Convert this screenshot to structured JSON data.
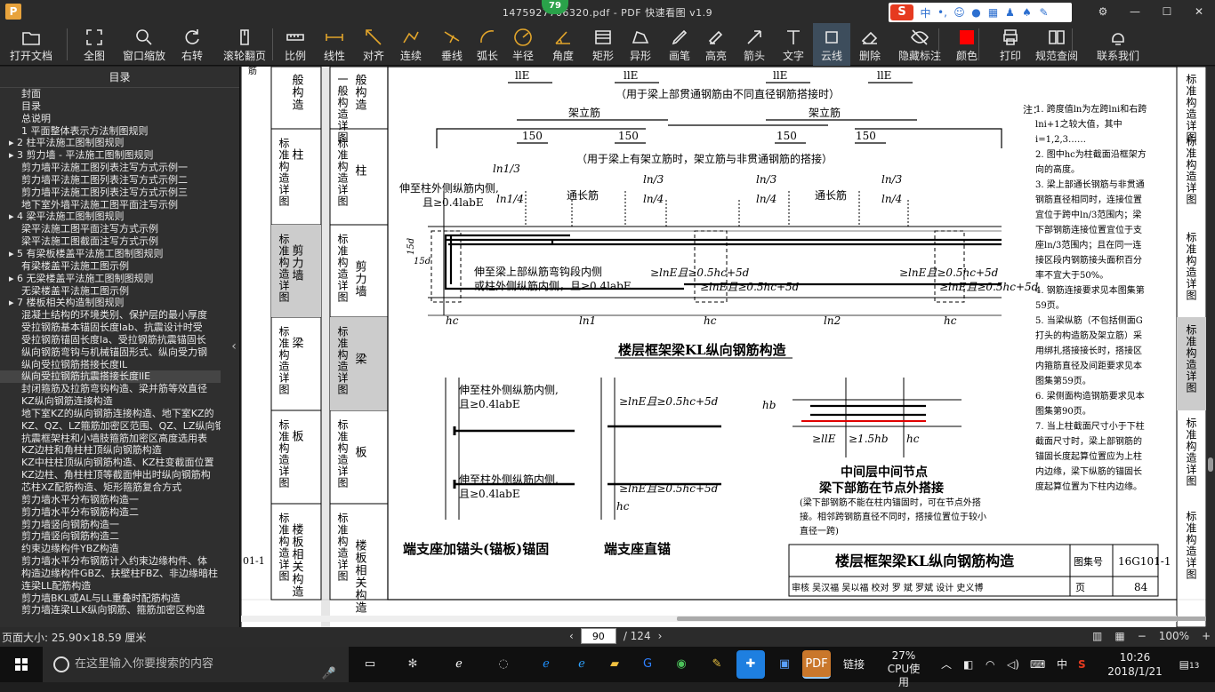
{
  "window": {
    "title": "1475927706320.pdf - PDF 快速看图 v1.9",
    "badge": "79",
    "app_icon": "P"
  },
  "ime": {
    "brand": "S",
    "mode": "中"
  },
  "toolbar": [
    {
      "label": "打开文档",
      "icon": "folder-icon"
    },
    {
      "label": "全图",
      "icon": "fullscreen-icon"
    },
    {
      "label": "窗口缩放",
      "icon": "zoom-icon"
    },
    {
      "label": "右转",
      "icon": "rotate-icon"
    },
    {
      "label": "滚轮翻页",
      "icon": "mouse-icon"
    },
    {
      "label": "比例",
      "icon": "scale-icon"
    },
    {
      "label": "线性",
      "icon": "linear-icon"
    },
    {
      "label": "对齐",
      "icon": "align-icon"
    },
    {
      "label": "连续",
      "icon": "continuous-icon"
    },
    {
      "label": "垂线",
      "icon": "perpendicular-icon"
    },
    {
      "label": "弧长",
      "icon": "arc-icon"
    },
    {
      "label": "半径",
      "icon": "radius-icon"
    },
    {
      "label": "角度",
      "icon": "angle-icon"
    },
    {
      "label": "矩形",
      "icon": "rectangle-icon"
    },
    {
      "label": "异形",
      "icon": "polygon-icon"
    },
    {
      "label": "画笔",
      "icon": "pen-icon"
    },
    {
      "label": "高亮",
      "icon": "highlighter-icon"
    },
    {
      "label": "箭头",
      "icon": "arrow-icon"
    },
    {
      "label": "文字",
      "icon": "text-icon"
    },
    {
      "label": "云线",
      "icon": "cloud-icon"
    },
    {
      "label": "删除",
      "icon": "eraser-icon"
    },
    {
      "label": "隐藏标注",
      "icon": "eye-off-icon"
    },
    {
      "label": "颜色",
      "icon": "color-icon",
      "color": "#ff0000"
    },
    {
      "label": "打印",
      "icon": "printer-icon"
    },
    {
      "label": "规范查阅",
      "icon": "book-icon"
    },
    {
      "label": "联系我们",
      "icon": "support-icon"
    }
  ],
  "sidebar": {
    "title": "目录",
    "items": [
      {
        "text": "封面",
        "level": 0
      },
      {
        "text": "目录",
        "level": 0
      },
      {
        "text": "总说明",
        "level": 0
      },
      {
        "text": "1 平面整体表示方法制图规则",
        "level": 0
      },
      {
        "text": "2 柱平法施工图制图规则",
        "level": 1,
        "expand": "▸"
      },
      {
        "text": "3 剪力墙 - 平法施工图制图规则",
        "level": 1,
        "expand": "▸"
      },
      {
        "text": "剪力墙平法施工图列表注写方式示例一",
        "level": 2
      },
      {
        "text": "剪力墙平法施工图列表注写方式示例二",
        "level": 2
      },
      {
        "text": "剪力墙平法施工图列表注写方式示例三",
        "level": 2
      },
      {
        "text": "地下室外墙平法施工图平面注写示例",
        "level": 2
      },
      {
        "text": "4 梁平法施工图制图规则",
        "level": 1,
        "expand": "▸"
      },
      {
        "text": "梁平法施工图平面注写方式示例",
        "level": 2
      },
      {
        "text": "梁平法施工图截面注写方式示例",
        "level": 2
      },
      {
        "text": "5 有梁板楼盖平法施工图制图规则",
        "level": 1,
        "expand": "▸"
      },
      {
        "text": "有梁楼盖平法施工图示例",
        "level": 2
      },
      {
        "text": "6 无梁楼盖平法施工图制图规则",
        "level": 1,
        "expand": "▸"
      },
      {
        "text": "无梁楼盖平法施工图示例",
        "level": 2
      },
      {
        "text": "7 楼板相关构造制图规则",
        "level": 1,
        "expand": "▸"
      },
      {
        "text": "混凝土结构的环境类别、保护层的最小厚度",
        "level": 2
      },
      {
        "text": "受拉钢筋基本锚固长度lab、抗震设计时受",
        "level": 2
      },
      {
        "text": "受拉钢筋锚固长度la、受拉钢筋抗震锚固长",
        "level": 2
      },
      {
        "text": "纵向钢筋弯钩与机械锚固形式、纵向受力钢",
        "level": 2
      },
      {
        "text": "纵向受拉钢筋搭接长度lL",
        "level": 2
      },
      {
        "text": "纵向受拉钢筋抗震搭接长度llE",
        "level": 2,
        "selected": true
      },
      {
        "text": "封闭箍筋及拉筋弯钩构造、梁并筋等效直径",
        "level": 2
      },
      {
        "text": "KZ纵向钢筋连接构造",
        "level": 2
      },
      {
        "text": "地下室KZ的纵向钢筋连接构造、地下室KZ的",
        "level": 2
      },
      {
        "text": "KZ、QZ、LZ箍筋加密区范围、QZ、LZ纵向钢",
        "level": 2
      },
      {
        "text": "抗震框架柱和小墙肢箍筋加密区高度选用表",
        "level": 2
      },
      {
        "text": "KZ边柱和角柱柱顶纵向钢筋构造",
        "level": 2
      },
      {
        "text": "KZ中柱柱顶纵向钢筋构造、KZ柱变截面位置",
        "level": 2
      },
      {
        "text": "KZ边柱、角柱柱顶等截面伸出时纵向钢筋构",
        "level": 2
      },
      {
        "text": "芯柱XZ配筋构造、矩形箍筋复合方式",
        "level": 2
      },
      {
        "text": "剪力墙水平分布钢筋构造一",
        "level": 2
      },
      {
        "text": "剪力墙水平分布钢筋构造二",
        "level": 2
      },
      {
        "text": "剪力墙竖向钢筋构造一",
        "level": 2
      },
      {
        "text": "剪力墙竖向钢筋构造二",
        "level": 2
      },
      {
        "text": "约束边缘构件YBZ构造",
        "level": 2
      },
      {
        "text": "剪力墙水平分布钢筋计入约束边缘构件、体",
        "level": 2
      },
      {
        "text": "构造边缘构件GBZ、扶壁柱FBZ、非边缘暗柱",
        "level": 2
      },
      {
        "text": "连梁LL配筋构造",
        "level": 2
      },
      {
        "text": "剪力墙BKL或AL与LL重叠时配筋构造",
        "level": 2
      },
      {
        "text": "剪力墙连梁LLK纵向钢筋、箍筋加密区构造",
        "level": 2
      }
    ]
  },
  "drawing": {
    "tabs_left": [
      {
        "a": "般构造",
        "b": ""
      },
      {
        "a": "标准构造详图",
        "b": "柱"
      },
      {
        "a": "标准构造详图",
        "b": "剪力墙"
      },
      {
        "a": "",
        "b": "梁"
      },
      {
        "a": "标准构造详图",
        "b": "板"
      },
      {
        "a": "标准构造详图",
        "b": "楼板相关构造"
      }
    ],
    "tabs_left_top": "一般构造详图",
    "tabs_left_text": [
      "般构造",
      "柱",
      "剪力墙",
      "梁",
      "板",
      "楼板相关构造"
    ],
    "tab_side": [
      "标准构造详图",
      "标准构造详图",
      "标准构造详图",
      "标准构造详图",
      "标准构造详图",
      "标准构造详图"
    ],
    "caption_lap_diff": "（用于梁上部贯通钢筋由不同直径钢筋搭接时）",
    "caption_frame_bar": "（用于梁上有架立筋时，架立筋与非贯通钢筋的搭接）",
    "label_frame_bar": "架立筋",
    "label_through": "通长筋",
    "dim_150": "150",
    "dim_ln1_3": "ln1/3",
    "dim_ln1_4": "ln1/4",
    "dim_ln_3": "ln/3",
    "dim_ln_4": "ln/4",
    "dim_lle": "llE",
    "dim_15d": "15d",
    "note_extend_1": "伸至柱外侧纵筋内侧,",
    "note_extend_2": "且≥0.4labE",
    "note_bend_1": "伸至梁上部纵筋弯钩段内侧",
    "note_bend_2": "或柱外侧纵筋内侧，且≥0.4labE",
    "dim_lne": "≥lnE且≥0.5hc+5d",
    "dim_hc": "hc",
    "dim_ln1": "ln1",
    "dim_ln2": "ln2",
    "dim_hb": "hb",
    "dim_llE_15": "≥llE",
    "dim_15hb": "≥1.5hb",
    "main_title": "楼层框架梁KL纵向钢筋构造",
    "sub_title_anchor": "端支座加锚头(锚板)锚固",
    "sub_title_straight": "端支座直锚",
    "node_title_1": "中间层中间节点",
    "node_title_2": "梁下部筋在节点外搭接",
    "node_note": "(梁下部钢筋不能在柱内锚固时，可在节点外搭接。相邻跨钢筋直径不同时，搭接位置位于较小直径一跨)",
    "notes_head": "注：",
    "notes": [
      "1. 跨度值ln为左跨lni和右跨lni+1之较大值，其中i=1,2,3……",
      "2. 图中hc为柱截面沿框架方向的高度。",
      "3. 梁上部通长钢筋与非贯通钢筋直径相同时，连接位置宜位于跨中ln/3范围内；梁下部钢筋连接位置宜位于支座ln/3范围内；且在同一连接区段内钢筋接头面积百分率不宜大于50%。",
      "4. 钢筋连接要求见本图集第59页。",
      "5. 当梁纵筋（不包括侧面G打头的构造筋及架立筋）采用绑扎搭接接长时，搭接区内箍筋直径及间距要求见本图集第59页。",
      "6. 梁侧面构造钢筋要求见本图集第90页。",
      "7. 当上柱截面尺寸小于下柱截面尺寸时，梁上部钢筋的锚固长度起算位置应为上柱内边缘，梁下纵筋的锚固长度起算位置为下柱内边缘。"
    ],
    "title_block": {
      "title": "楼层框架梁KL纵向钢筋构造",
      "atlas_label": "图集号",
      "atlas_no": "16G101-1",
      "page_label": "页",
      "page_no": "84",
      "review_row": "审核 吴汉福 吴以福 校对 罗 斌 罗斌 设计 史义博"
    },
    "left_fragment": "01-1",
    "left_tab_fragment": "筋"
  },
  "right_tabs": [
    "标准构造详图",
    "标准构造详图",
    "标准构造详图",
    "标准构造详图",
    "标准构造详图",
    "标准构造详图"
  ],
  "status": {
    "page_size": "页面大小: 25.90×18.59 厘米",
    "page_current": "90",
    "page_total": "/ 124",
    "zoom": "100%"
  },
  "taskbar": {
    "search_placeholder": "在这里输入你要搜索的内容",
    "link_label": "链接",
    "cpu_percent": "27%",
    "cpu_label": "CPU使用",
    "ime_mode": "中",
    "time": "10:26",
    "date": "2018/1/21",
    "notif_count": "13"
  }
}
